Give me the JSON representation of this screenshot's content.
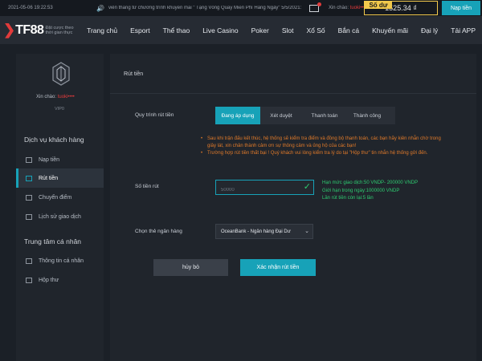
{
  "topbar": {
    "datetime": "2021-05-06 19:22:53",
    "marquee": "viên thắng từ chương trình khuyến mãi \" Tặng Vòng Quay Miễn Phí Hàng Ngày\" 5/5/2021: tuoki",
    "greeting": "Xin chào:",
    "username": "tuoki••••",
    "balance_label": "Số dư",
    "balance_value": "1525.34 ₫",
    "deposit_label": "Nạp tiền"
  },
  "nav": {
    "logo_text": "TF88",
    "tagline": "Đặt cược theo thời gian thực",
    "items": [
      "Trang chủ",
      "Esport",
      "Thể thao",
      "Live Casino",
      "Poker",
      "Slot",
      "Xổ Số",
      "Bắn cá",
      "Khuyến mãi",
      "Đại lý",
      "Tải APP"
    ]
  },
  "sidebar": {
    "greeting": "Xin chào:",
    "username": "tuoki••••",
    "vip": "VIP0",
    "section1": "Dịch vụ khách hàng",
    "items1": [
      "Nạp tiền",
      "Rút tiền",
      "Chuyển điểm",
      "Lịch sử giao dịch"
    ],
    "section2": "Trung tâm cá nhân",
    "items2": [
      "Thông tin cá nhân",
      "Hộp thư"
    ]
  },
  "main": {
    "title": "Rút tiền",
    "process_label": "Quy trình rút tiền",
    "steps": [
      "Đang áp dụng",
      "Xét duyệt",
      "Thanh toán",
      "Thành công"
    ],
    "notes": [
      "Sau khi trận đấu kết thúc, hệ thống sẽ kiểm tra điểm và đồng bộ thanh toán, các bạn hãy kiên nhẫn chờ trong giây lát, xin chân thành cảm ơn sự thông cảm và ủng hộ của các bạn!",
      "Trường hợp rút tiền thất bại ! Quý khách vui lòng kiểm tra lý do tại \"Hộp thư\" tin nhắn hệ thống gửi đến."
    ],
    "amount_label": "Số tiền rút",
    "amount_value": "50000",
    "limits": [
      "Hạn mức giao dịch:50 VNDP- 200000 VNDP",
      "Giới hạn trong ngày:1000000 VNDP",
      "Lần rút tiền còn lại:5 lần"
    ],
    "bank_label": "Chọn thẻ ngân hàng",
    "bank_value": "OceanBank - Ngân hàng Đại Dư",
    "cancel_label": "hủy bỏ",
    "confirm_label": "Xác nhận rút tiền"
  },
  "colors": {
    "accent": "#17a2b8",
    "gold": "#f2c94c",
    "warning": "#e07a2a",
    "success": "#2ecc71",
    "alert": "#e23b3b"
  }
}
